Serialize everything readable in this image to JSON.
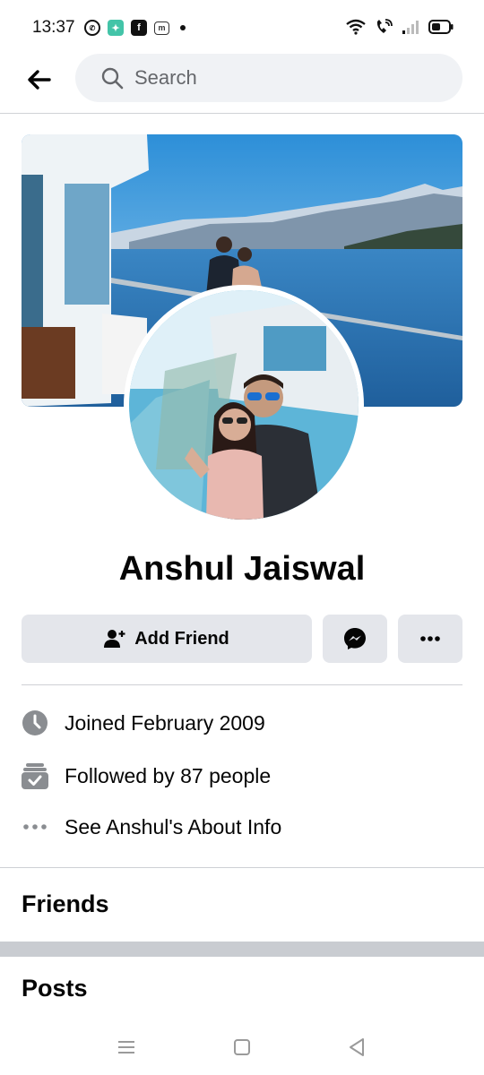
{
  "status_bar": {
    "time": "13:37",
    "app_icons": [
      "whatsapp-icon",
      "app-icon",
      "facebook-icon",
      "messages-icon"
    ],
    "system_icons": [
      "wifi-icon",
      "wifi-calling-icon",
      "signal-icon",
      "battery-icon"
    ]
  },
  "header": {
    "search_placeholder": "Search"
  },
  "profile": {
    "name": "Anshul Jaiswal"
  },
  "actions": {
    "add_friend_label": "Add Friend",
    "messenger_icon": "messenger-icon",
    "more_icon": "more-dots-icon"
  },
  "info": {
    "joined": "Joined February 2009",
    "followed": "Followed by 87 people",
    "about": "See Anshul's About Info"
  },
  "sections": {
    "friends": "Friends",
    "posts": "Posts"
  },
  "colors": {
    "button_bg": "#e4e6eb",
    "search_bg": "#f0f2f5",
    "text_primary": "#050505",
    "text_secondary": "#65676b"
  }
}
